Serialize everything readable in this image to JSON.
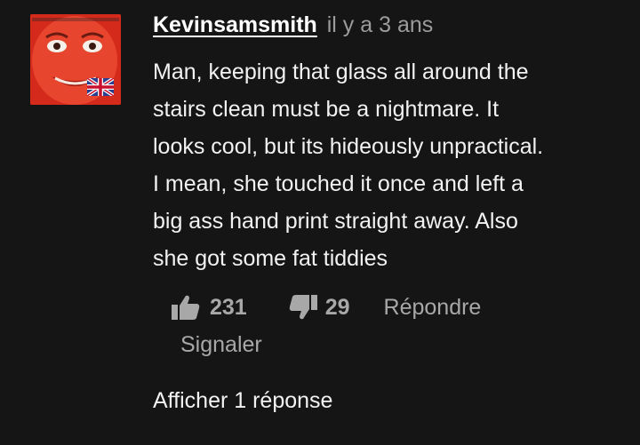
{
  "comment": {
    "author": "Kevinsamsmith",
    "time": "il y a 3 ans",
    "lines": [
      "Man, keeping that glass all around the",
      "stairs clean must be a nightmare. It",
      "looks cool, but its hideously unpractical.",
      "I mean, she touched it once and left a",
      "big ass hand print straight away. Also",
      "she got some fat tiddies"
    ]
  },
  "actions": {
    "likes": "231",
    "dislikes": "29",
    "reply_label": "Répondre",
    "report_label": "Signaler"
  },
  "replies": {
    "show_label": "Afficher 1 réponse"
  },
  "colors": {
    "background": "#151515",
    "text": "#f2f2f2",
    "muted": "#a8a8a8"
  },
  "icons": {
    "like": "thumbs-up-icon",
    "dislike": "thumbs-down-icon",
    "avatar_flag": "uk-flag-icon"
  }
}
